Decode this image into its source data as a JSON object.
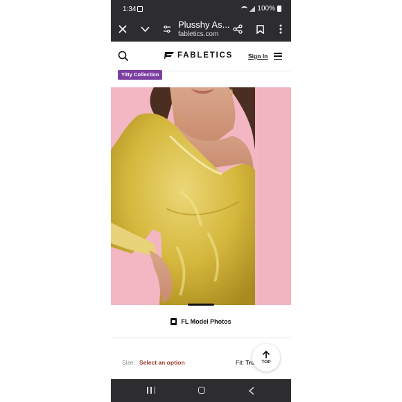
{
  "status_bar": {
    "time": "1:34",
    "battery": "100%"
  },
  "browser": {
    "tab_title": "Plusshy As...",
    "url": "fabletics.com"
  },
  "site": {
    "brand": "FABLETICS",
    "sign_in": "Sign In"
  },
  "badge": {
    "label": "Yitty Collection"
  },
  "gallery": {
    "model_photos_label": "FL Model Photos"
  },
  "size": {
    "label": "Size:",
    "select_label": "Select an option"
  },
  "fit": {
    "label": "Fit:",
    "value": "Tru",
    "value_end": "e"
  },
  "top_button": {
    "label": "TOP"
  },
  "colors": {
    "dress": "#d4b73c",
    "backdrop": "#f3b6c3",
    "badge": "#7b3fa0",
    "size_select": "#9a3a2a",
    "chrome": "#2d2d30"
  },
  "icons": [
    "close-icon",
    "chevron-down-icon",
    "tune-icon",
    "share-icon",
    "bookmark-icon",
    "more-icon",
    "search-icon",
    "menu-icon",
    "camera-icon",
    "arrow-up-icon"
  ]
}
